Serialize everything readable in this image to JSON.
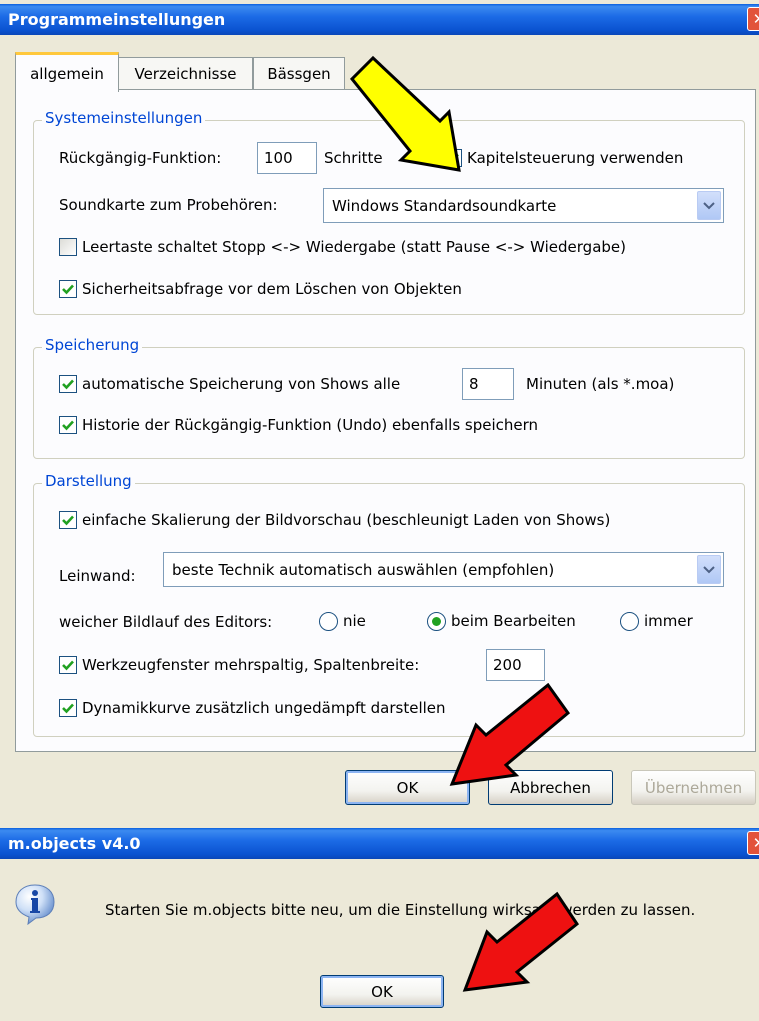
{
  "dialog": {
    "title": "Programmeinstellungen",
    "tabs": [
      "allgemein",
      "Verzeichnisse",
      "Bässgen"
    ],
    "systemeinstellungen": {
      "title": "Systemeinstellungen",
      "undo_label": "Rückgängig-Funktion:",
      "undo_value": "100",
      "undo_unit": "Schritte",
      "chapter_control_label": "Kapitelsteuerung verwenden",
      "chapter_control_checked": true,
      "soundcard_label": "Soundkarte zum Probehören:",
      "soundcard_value": "Windows Standardsoundkarte",
      "space_toggle_label": "Leertaste schaltet Stopp <-> Wiedergabe (statt Pause <-> Wiedergabe)",
      "space_toggle_checked": false,
      "delete_confirm_label": "Sicherheitsabfrage vor dem Löschen von Objekten",
      "delete_confirm_checked": true
    },
    "speicherung": {
      "title": "Speicherung",
      "autosave_label": "automatische Speicherung von Shows alle",
      "autosave_value": "8",
      "autosave_unit": "Minuten (als *.moa)",
      "autosave_checked": true,
      "history_label": "Historie der Rückgängig-Funktion (Undo) ebenfalls speichern",
      "history_checked": true
    },
    "darstellung": {
      "title": "Darstellung",
      "simple_scaling_label": "einfache Skalierung der Bildvorschau (beschleunigt Laden von Shows)",
      "simple_scaling_checked": true,
      "canvas_label": "Leinwand:",
      "canvas_value": "beste Technik automatisch auswählen (empfohlen)",
      "scroll_label": "weicher Bildlauf des Editors:",
      "scroll_options": [
        "nie",
        "beim Bearbeiten",
        "immer"
      ],
      "scroll_selected": "beim Bearbeiten",
      "toolwindow_label": "Werkzeugfenster mehrspaltig, Spaltenbreite:",
      "toolwindow_value": "200",
      "toolwindow_checked": true,
      "dynamics_label": "Dynamikkurve zusätzlich ungedämpft darstellen",
      "dynamics_checked": true
    },
    "buttons": {
      "ok": "OK",
      "cancel": "Abbrechen",
      "apply": "Übernehmen"
    }
  },
  "messagebox": {
    "title": "m.objects v4.0",
    "icon": "info-icon",
    "text": "Starten Sie m.objects bitte neu, um die Einstellung wirksam werden zu lassen.",
    "ok": "OK"
  },
  "annotations": {
    "yellow_arrow_color": "#FFFF00",
    "red_arrow_color": "#EE1111"
  }
}
